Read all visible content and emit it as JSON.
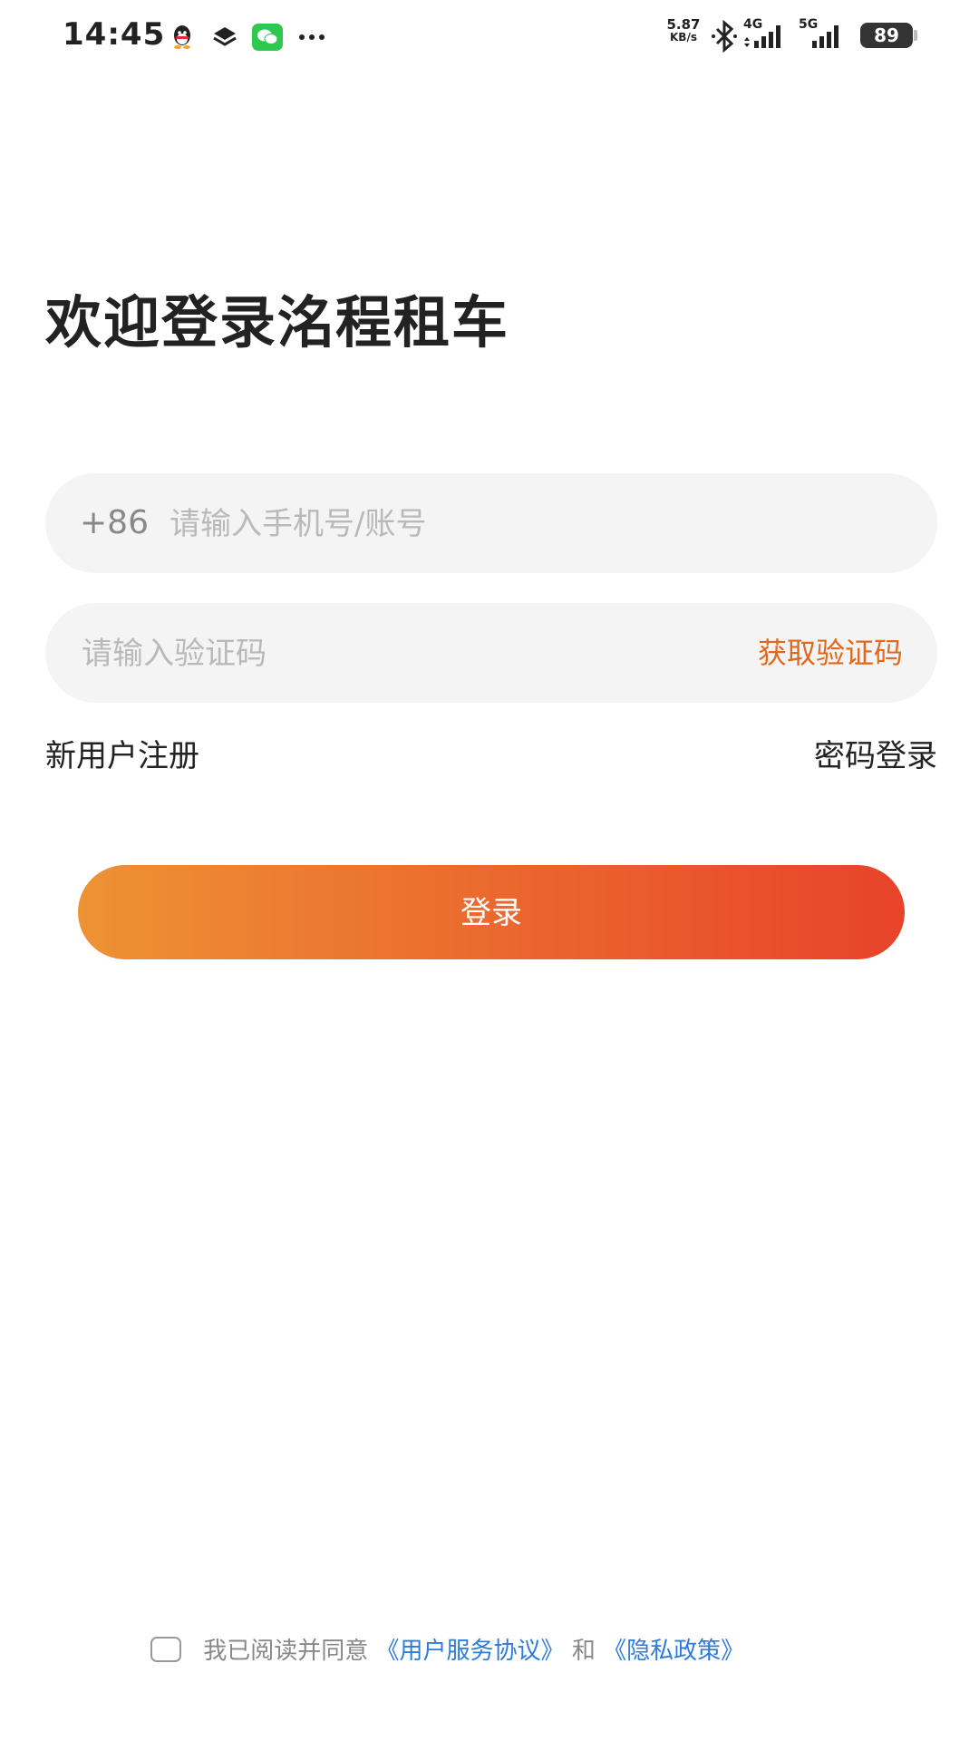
{
  "status_bar": {
    "time": "14:45",
    "net_speed_value": "5.87",
    "net_speed_unit": "KB/s",
    "network_1": "4G",
    "network_2": "5G",
    "battery": "89",
    "icons": [
      "qq-icon",
      "layers-icon",
      "wechat-icon",
      "more-dots-icon",
      "bluetooth-icon",
      "signal-icon"
    ]
  },
  "title": "欢迎登录洺程租车",
  "phone_field": {
    "country_code": "+86",
    "placeholder": "请输入手机号/账号"
  },
  "code_field": {
    "placeholder": "请输入验证码",
    "get_code_label": "获取验证码"
  },
  "links": {
    "register": "新用户注册",
    "password_login": "密码登录"
  },
  "login_button": "登录",
  "agreement": {
    "prefix": "我已阅读并同意",
    "user_agreement": "《用户服务协议》",
    "and": "和",
    "privacy_policy": "《隐私政策》"
  },
  "colors": {
    "accent": "#e0691e",
    "button_gradient_start": "#ee9234",
    "button_gradient_end": "#e8432a",
    "link_blue": "#2f7bd9"
  }
}
